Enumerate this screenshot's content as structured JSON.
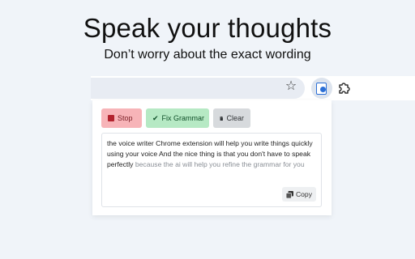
{
  "hero": {
    "headline": "Speak your thoughts",
    "subheadline": "Don’t worry about the exact wording"
  },
  "browser": {
    "star_icon": "star-icon",
    "extension_icon": "voice-writer-extension-icon",
    "puzzle_icon": "extensions-puzzle-icon"
  },
  "popup": {
    "buttons": {
      "stop": "Stop",
      "fix_grammar": "Fix Grammar",
      "clear": "Clear",
      "copy": "Copy"
    },
    "transcript": {
      "final_text": "the voice writer Chrome extension will help you write things quickly using your voice And the nice thing is that you don't have to speak perfectly",
      "interim_text": " because the ai will help you refine the grammar for you"
    }
  },
  "colors": {
    "stop_bg": "#f7b4b8",
    "fix_bg": "#b6e9c4",
    "clear_bg": "#d7dadd",
    "accent": "#2b6fd6"
  }
}
